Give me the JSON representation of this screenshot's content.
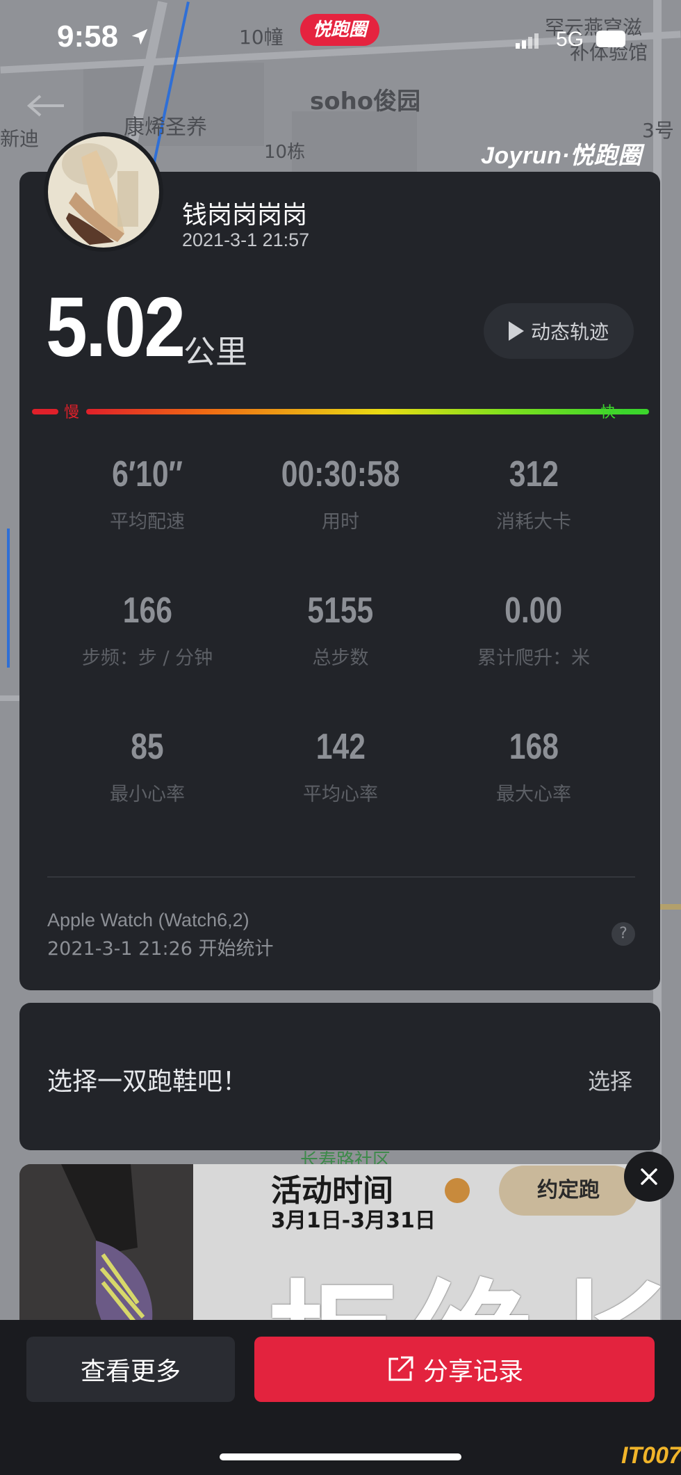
{
  "status_bar": {
    "time": "9:58",
    "network": "5G",
    "badge": "悦跑圈"
  },
  "map": {
    "labels": [
      "10幢",
      "soho俊园",
      "康烯圣养",
      "10栋",
      "新迪",
      "3号",
      "罕云燕穹滋",
      "补体验馆",
      "长寿路社区"
    ]
  },
  "brand": {
    "logo": "Joyrun·悦跑圈"
  },
  "user": {
    "name": "钱岗岗岗岗",
    "datetime": "2021-3-1 21:57"
  },
  "summary": {
    "distance": "5.02",
    "distance_unit": "公里",
    "replay_label": "动态轨迹"
  },
  "pace_bar": {
    "slow_label": "慢",
    "fast_label": "快"
  },
  "stats": [
    {
      "value": "6′10″",
      "label": "平均配速"
    },
    {
      "value": "00:30:58",
      "label": "用时"
    },
    {
      "value": "312",
      "label": "消耗大卡"
    },
    {
      "value": "166",
      "label": "步频：步 / 分钟"
    },
    {
      "value": "5155",
      "label": "总步数"
    },
    {
      "value": "0.00",
      "label": "累计爬升：米"
    },
    {
      "value": "85",
      "label": "最小心率"
    },
    {
      "value": "142",
      "label": "平均心率"
    },
    {
      "value": "168",
      "label": "最大心率"
    }
  ],
  "device": {
    "name": "Apple Watch (Watch6,2)",
    "start_note": "2021-3-1 21:26 开始统计",
    "help": "?"
  },
  "shoe": {
    "prompt": "选择一双跑鞋吧！",
    "action": "选择"
  },
  "banner": {
    "title": "活动时间",
    "dates": "3月1日-3月31日",
    "tag": "约定跑",
    "headline": "拒绝长"
  },
  "actions": {
    "more": "查看更多",
    "share": "分享记录"
  },
  "watermark": "IT007"
}
